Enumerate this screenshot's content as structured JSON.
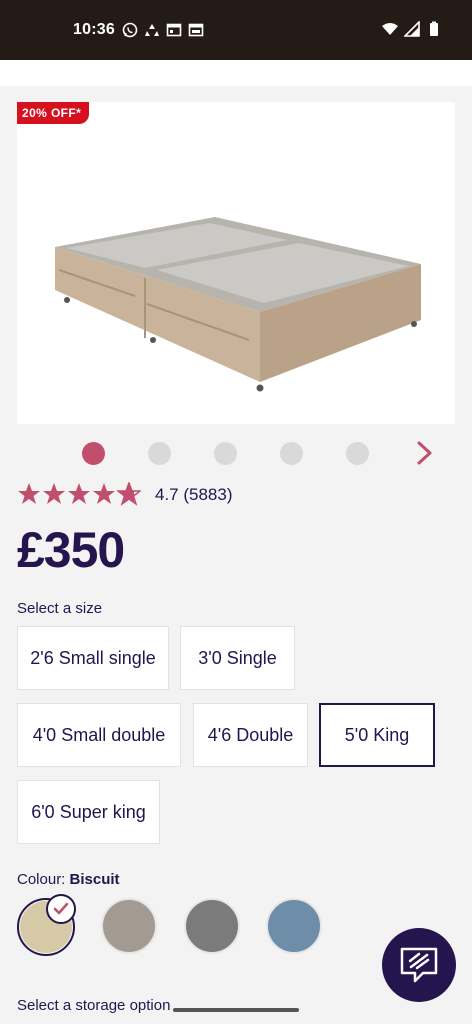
{
  "status_bar": {
    "time": "10:36",
    "left_icons": [
      "whatsapp-icon",
      "recycle-icon",
      "calendar-icon",
      "browser-icon"
    ],
    "right_icons": [
      "wifi-icon",
      "signal-icon",
      "battery-icon"
    ]
  },
  "product": {
    "badge": "20% OFF*",
    "image_alt": "divan bed base",
    "carousel": {
      "total": 5,
      "active_index": 0
    },
    "rating": {
      "stars": 4.7,
      "text": "4.7 (5883)"
    },
    "price": "£350"
  },
  "size": {
    "label": "Select a size",
    "options": [
      "2'6 Small single",
      "3'0 Single",
      "4'0 Small double",
      "4'6 Double",
      "5'0 King",
      "6'0 Super king"
    ],
    "selected": "5'0 King"
  },
  "colour": {
    "label_prefix": "Colour:",
    "selected_name": "Biscuit",
    "swatches": [
      {
        "name": "Biscuit",
        "color": "#d6c9a6"
      },
      {
        "name": "Mink",
        "color": "#a39a91"
      },
      {
        "name": "Grey",
        "color": "#7b7b7b"
      },
      {
        "name": "Blue",
        "color": "#6d8da8"
      }
    ]
  },
  "storage": {
    "label": "Select a storage option"
  },
  "colors": {
    "brand": "#24154f",
    "accent": "#c04e6c",
    "badge": "#d5101f"
  }
}
